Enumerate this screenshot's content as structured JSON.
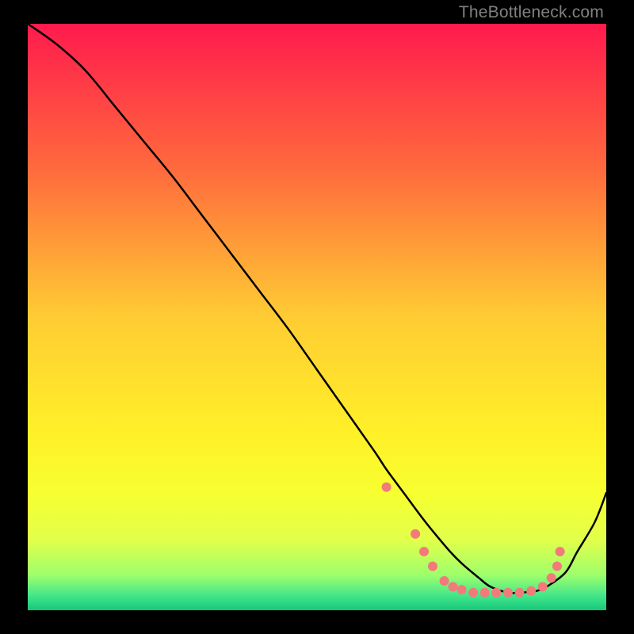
{
  "watermark": "TheBottleneck.com",
  "chart_data": {
    "type": "line",
    "title": "",
    "xlabel": "",
    "ylabel": "",
    "xlim": [
      0,
      100
    ],
    "ylim": [
      0,
      100
    ],
    "grid": false,
    "axes_visible": false,
    "background": {
      "type": "vertical-gradient",
      "stops": [
        {
          "pos": 0.0,
          "color": "#ff1a4d"
        },
        {
          "pos": 0.25,
          "color": "#ff6b3d"
        },
        {
          "pos": 0.5,
          "color": "#ffcc33"
        },
        {
          "pos": 0.7,
          "color": "#fff028"
        },
        {
          "pos": 0.8,
          "color": "#f7ff30"
        },
        {
          "pos": 0.88,
          "color": "#e2ff4a"
        },
        {
          "pos": 0.94,
          "color": "#9eff6c"
        },
        {
          "pos": 0.975,
          "color": "#43e68a"
        },
        {
          "pos": 1.0,
          "color": "#15c87a"
        }
      ]
    },
    "series": [
      {
        "name": "bottleneck-curve",
        "color": "#000000",
        "stroke_width": 2.5,
        "x": [
          0,
          5,
          10,
          15,
          20,
          25,
          30,
          35,
          40,
          45,
          50,
          55,
          60,
          62,
          65,
          68,
          70,
          73,
          75,
          78,
          80,
          83,
          85,
          88,
          90,
          93,
          95,
          98,
          100
        ],
        "y": [
          100,
          96.5,
          92,
          86,
          80,
          74,
          67.5,
          61,
          54.5,
          48,
          41,
          34,
          27,
          24,
          20,
          16,
          13.5,
          10,
          8,
          5.5,
          4,
          3,
          3,
          3.3,
          4.2,
          6.5,
          10,
          15,
          20
        ]
      }
    ],
    "markers": {
      "color": "#f27a7a",
      "radius": 6,
      "points": [
        {
          "x": 62,
          "y": 21
        },
        {
          "x": 67,
          "y": 13
        },
        {
          "x": 68.5,
          "y": 10
        },
        {
          "x": 70,
          "y": 7.5
        },
        {
          "x": 72,
          "y": 5
        },
        {
          "x": 73.5,
          "y": 4
        },
        {
          "x": 75,
          "y": 3.5
        },
        {
          "x": 77,
          "y": 3
        },
        {
          "x": 79,
          "y": 3
        },
        {
          "x": 81,
          "y": 3
        },
        {
          "x": 83,
          "y": 3
        },
        {
          "x": 85,
          "y": 3
        },
        {
          "x": 87,
          "y": 3.3
        },
        {
          "x": 89,
          "y": 4
        },
        {
          "x": 90.5,
          "y": 5.5
        },
        {
          "x": 91.5,
          "y": 7.5
        },
        {
          "x": 92,
          "y": 10
        }
      ]
    }
  }
}
